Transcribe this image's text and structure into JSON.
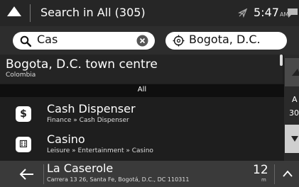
{
  "header": {
    "title": "Search in All (305)",
    "time": "5:47",
    "ampm": "AM"
  },
  "search": {
    "query": "Cas",
    "location": "Bogota, D.C."
  },
  "results": {
    "top": {
      "title": "Bogota, D.C. town centre",
      "subtitle": "Colombia"
    },
    "section_header": "All",
    "items": [
      {
        "title": "Cash Dispenser",
        "subtitle": "Finance » Cash Dispenser",
        "icon": "dollar-icon"
      },
      {
        "title": "Casino",
        "subtitle": "Leisure » Entertainment » Casino",
        "icon": "casino-icon"
      }
    ]
  },
  "side": {
    "letter": "A",
    "number": "30"
  },
  "bottom": {
    "title": "La Caserole",
    "subtitle": "Carrera 13 26, Santa Fe, Bogotá, D.C., DC 110311",
    "distance": "12",
    "unit": "m"
  },
  "colors": {
    "background": "#1b1b1b",
    "pill": "#ffffff",
    "bottom_bar": "#3a3a3a"
  }
}
